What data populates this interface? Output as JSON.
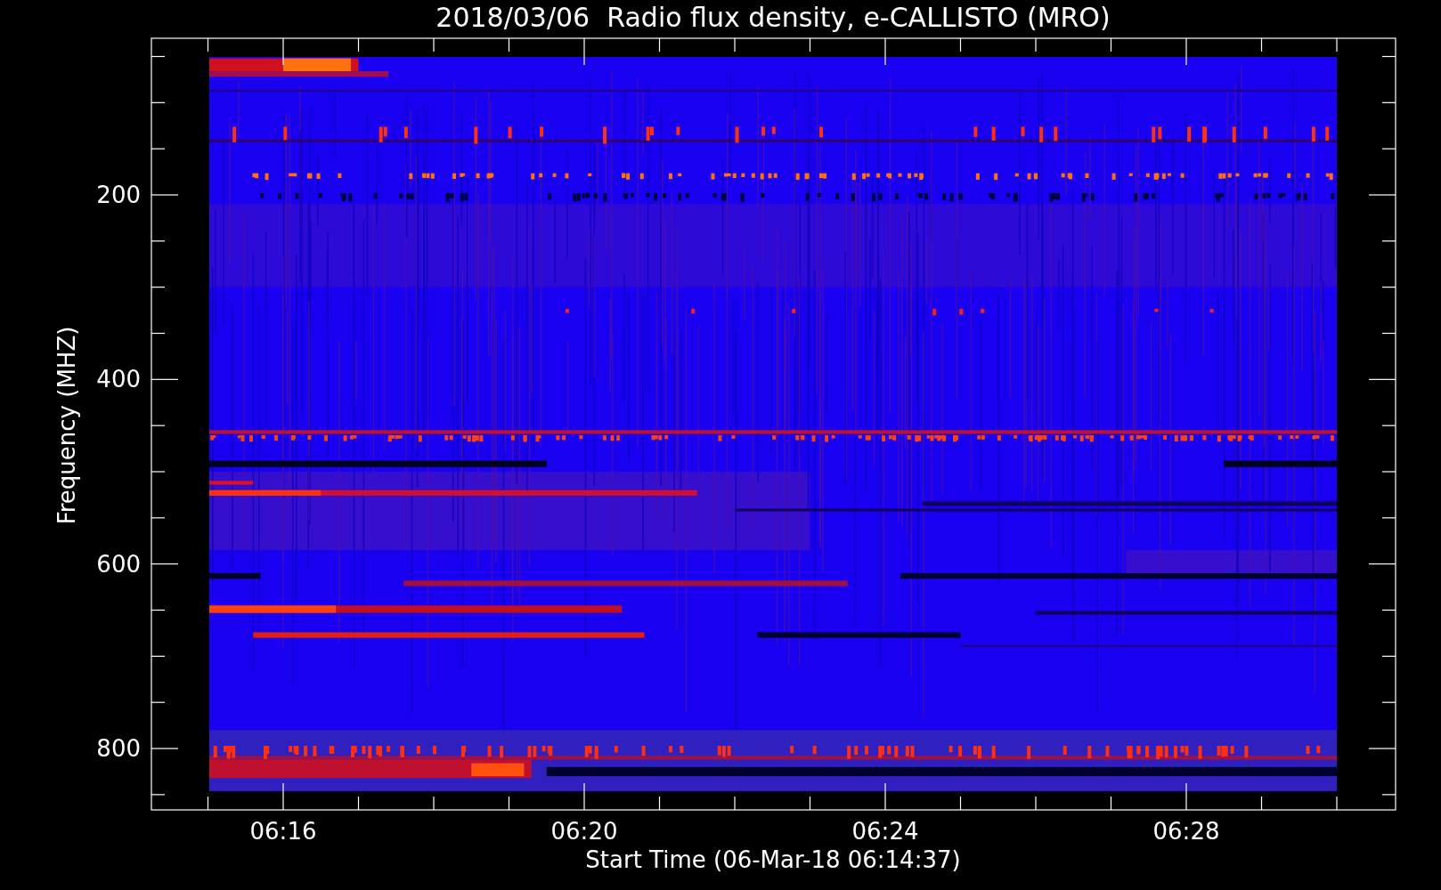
{
  "title": "2018/03/06  Radio flux density, e-CALLISTO (MRO)",
  "xlabel": "Start Time (06-Mar-18 06:14:37)",
  "ylabel": "Frequency (MHZ)",
  "x_ticks": [
    "06:16",
    "06:20",
    "06:24",
    "06:28"
  ],
  "y_ticks": [
    "200",
    "400",
    "600",
    "800"
  ]
}
